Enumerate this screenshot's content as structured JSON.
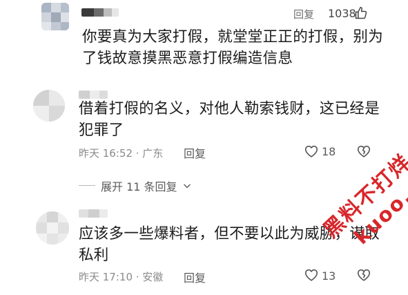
{
  "comments": [
    {
      "text_lines": [
        "你要真为大家打假，就堂堂正正的打假，别为",
        "了钱故意摸黑恶意打假编造信息"
      ],
      "reply_label": "回复",
      "like_count": "1038"
    },
    {
      "text_lines": [
        "借着打假的名义，对他人勒索钱财，这已经是",
        "犯罪了"
      ],
      "meta": "昨天 16:52 · 广东",
      "reply_label": "回复",
      "like_count": "18"
    },
    {
      "text_lines": [
        "应该多一些爆料者，但不要以此为威胁，谋取",
        "私利"
      ],
      "meta": "昨天 17:10 · 安徽",
      "reply_label": "回复",
      "like_count": "13"
    }
  ],
  "expand_replies_label": "展开 11 条回复",
  "watermark": {
    "line1": "黑料不打烊",
    "line2": "kuoo.cn"
  },
  "colors": {
    "text": "#1b1b1b",
    "meta": "#8a8a8a",
    "watermark": "#d8262a"
  },
  "icons": [
    "thumbs-up-icon",
    "heart-icon",
    "broken-heart-icon",
    "chevron-down-icon"
  ]
}
